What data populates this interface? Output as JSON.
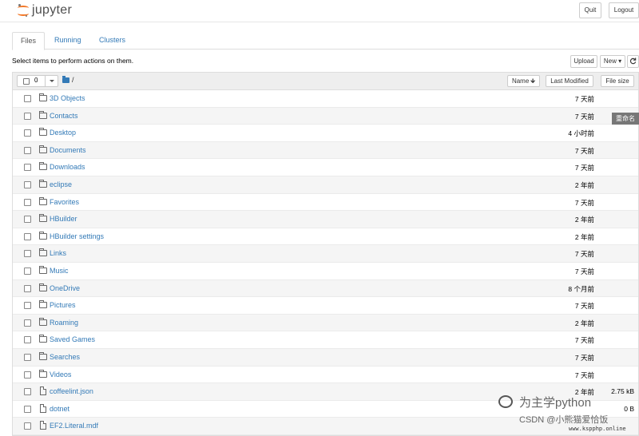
{
  "header": {
    "logo_text": "jupyter",
    "quit_label": "Quit",
    "logout_label": "Logout"
  },
  "tabs": [
    {
      "label": "Files"
    },
    {
      "label": "Running"
    },
    {
      "label": "Clusters"
    }
  ],
  "toolbar": {
    "hint": "Select items to perform actions on them.",
    "upload_label": "Upload",
    "new_label": "New ▾",
    "refresh_icon": "refresh-icon"
  },
  "list_header": {
    "selected_count": "0",
    "path": "/",
    "sort_name_label": "Name",
    "sort_arrow": "🡻",
    "last_modified_label": "Last Modified",
    "file_size_label": "File size"
  },
  "rows": [
    {
      "type": "folder",
      "name": "3D Objects",
      "modified": "7 天前",
      "size": ""
    },
    {
      "type": "folder",
      "name": "Contacts",
      "modified": "7 天前",
      "size": ""
    },
    {
      "type": "folder",
      "name": "Desktop",
      "modified": "4 小时前",
      "size": ""
    },
    {
      "type": "folder",
      "name": "Documents",
      "modified": "7 天前",
      "size": ""
    },
    {
      "type": "folder",
      "name": "Downloads",
      "modified": "7 天前",
      "size": ""
    },
    {
      "type": "folder",
      "name": "eclipse",
      "modified": "2 年前",
      "size": ""
    },
    {
      "type": "folder",
      "name": "Favorites",
      "modified": "7 天前",
      "size": ""
    },
    {
      "type": "folder",
      "name": "HBuilder",
      "modified": "2 年前",
      "size": ""
    },
    {
      "type": "folder",
      "name": "HBuilder settings",
      "modified": "2 年前",
      "size": ""
    },
    {
      "type": "folder",
      "name": "Links",
      "modified": "7 天前",
      "size": ""
    },
    {
      "type": "folder",
      "name": "Music",
      "modified": "7 天前",
      "size": ""
    },
    {
      "type": "folder",
      "name": "OneDrive",
      "modified": "8 个月前",
      "size": ""
    },
    {
      "type": "folder",
      "name": "Pictures",
      "modified": "7 天前",
      "size": ""
    },
    {
      "type": "folder",
      "name": "Roaming",
      "modified": "2 年前",
      "size": ""
    },
    {
      "type": "folder",
      "name": "Saved Games",
      "modified": "7 天前",
      "size": ""
    },
    {
      "type": "folder",
      "name": "Searches",
      "modified": "7 天前",
      "size": ""
    },
    {
      "type": "folder",
      "name": "Videos",
      "modified": "7 天前",
      "size": ""
    },
    {
      "type": "file",
      "name": "coffeelint.json",
      "modified": "2 年前",
      "size": "2.75 kB"
    },
    {
      "type": "file",
      "name": "dotnet",
      "modified": "",
      "size": "0 B"
    },
    {
      "type": "file",
      "name": "EF2.Literal.mdf",
      "modified": "",
      "size": ""
    }
  ],
  "float_badge": "重命名",
  "watermark": {
    "title": "为主学python",
    "subtitle": "CSDN @小熊猫爱恰饭",
    "url": "www.kspphp.online"
  }
}
